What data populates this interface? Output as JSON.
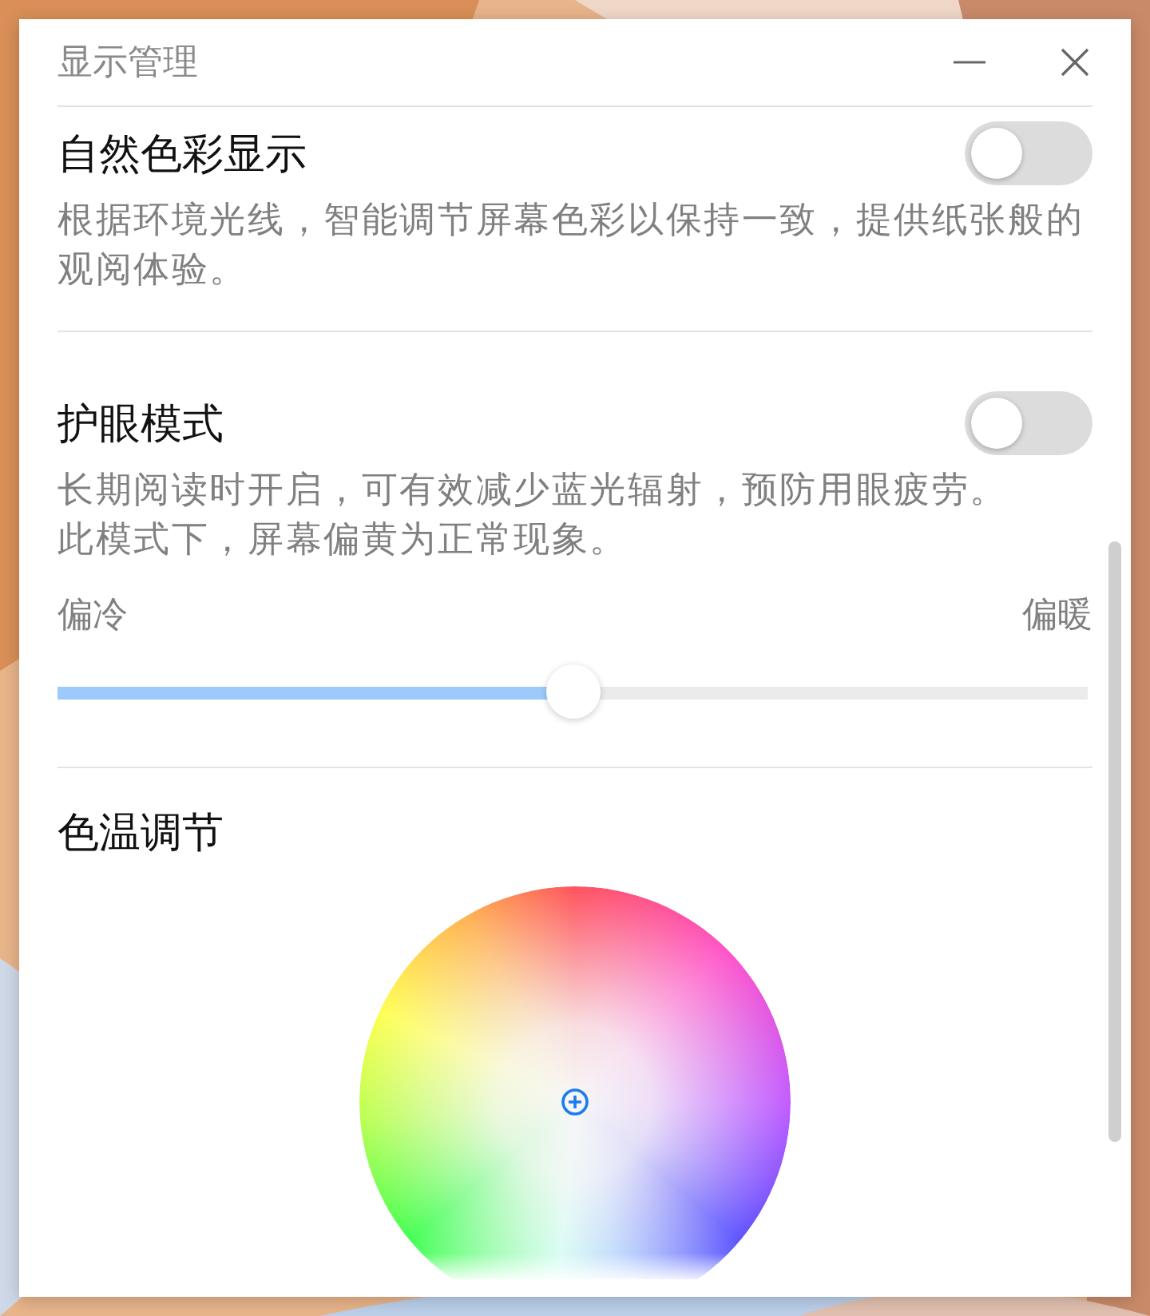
{
  "window": {
    "title": "显示管理"
  },
  "sections": [
    {
      "kind": "toggle",
      "title": "自然色彩显示",
      "on": false,
      "description": [
        "根据环境光线，智能调节屏幕色彩以保持一致，提供纸张般的",
        "观阅体验。"
      ]
    },
    {
      "kind": "toggle",
      "title": "护眼模式",
      "on": false,
      "description": [
        "长期阅读时开启，可有效减少蓝光辐射，预防用眼疲劳。",
        "此模式下，屏幕偏黄为正常现象。"
      ],
      "slider": {
        "min_label": "偏冷",
        "max_label": "偏暖",
        "level": 0.5
      }
    },
    {
      "kind": "color_wheel",
      "title": "色温调节"
    }
  ]
}
